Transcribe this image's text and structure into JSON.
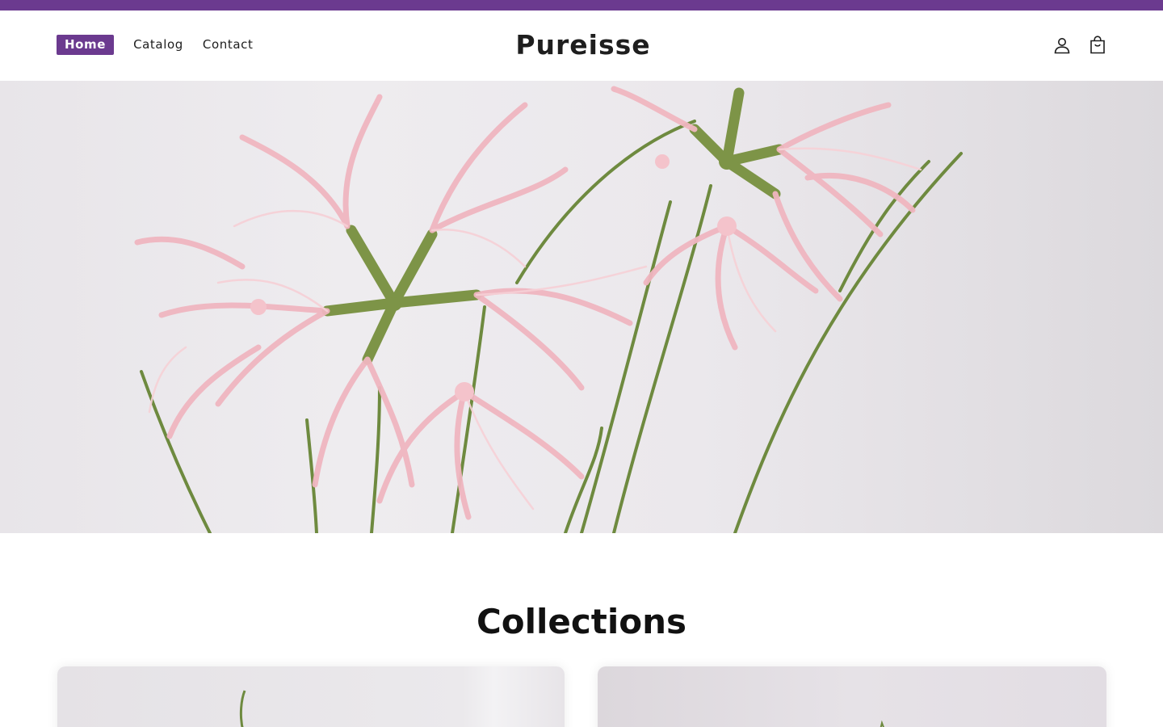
{
  "brand": {
    "name": "Pureisse",
    "accent": "#6b3a8f"
  },
  "nav": {
    "items": [
      {
        "label": "Home",
        "active": true
      },
      {
        "label": "Catalog",
        "active": false
      },
      {
        "label": "Contact",
        "active": false
      }
    ]
  },
  "header_icons": {
    "account": "account-icon",
    "cart": "cart-icon"
  },
  "hero": {
    "image": "pink-spider-lily-flowers"
  },
  "collections": {
    "title": "Collections",
    "cards": [
      {
        "image": "flower-stem-image"
      },
      {
        "image": "flower-arrangement-image"
      }
    ]
  }
}
